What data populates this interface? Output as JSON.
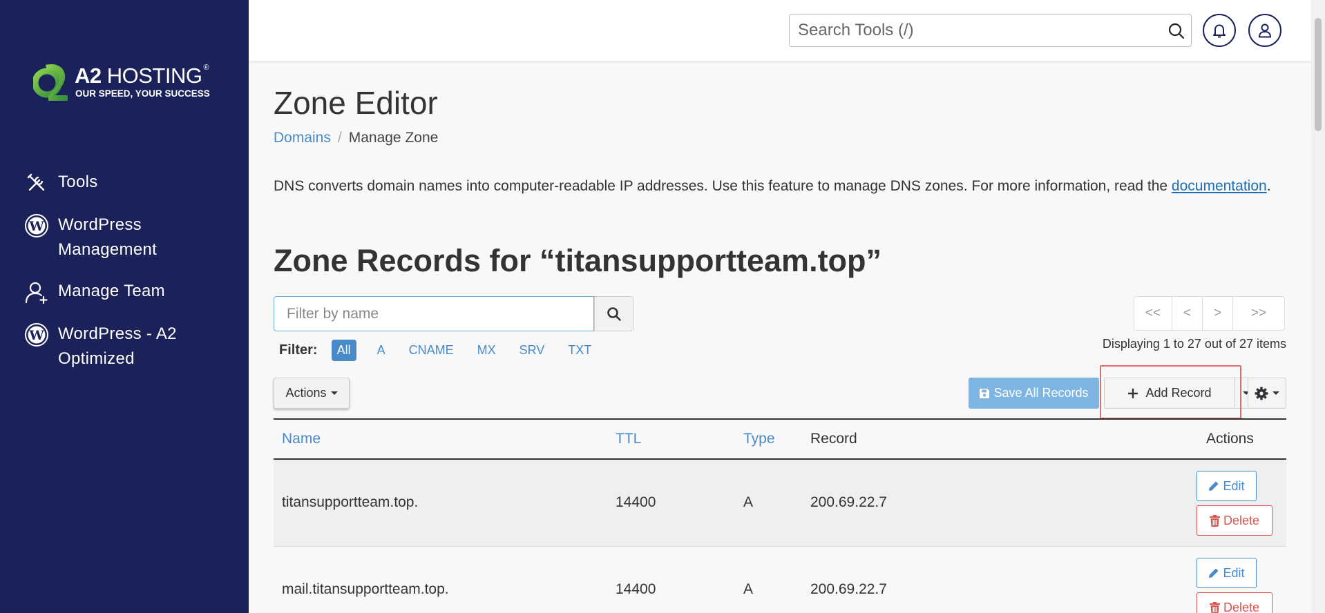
{
  "sidebar": {
    "logo_word_bold": "A2",
    "logo_word": "HOSTING",
    "logo_reg": "®",
    "logo_tagline": "OUR SPEED, YOUR SUCCESS",
    "items": [
      {
        "label": "Tools",
        "icon": "tools-icon"
      },
      {
        "label": "WordPress Management",
        "icon": "wordpress-icon"
      },
      {
        "label": "Manage Team",
        "icon": "user-plus-icon"
      },
      {
        "label": "WordPress - A2 Optimized",
        "icon": "wordpress-icon"
      }
    ]
  },
  "topbar": {
    "search_placeholder": "Search Tools (/)"
  },
  "page": {
    "title": "Zone Editor",
    "breadcrumb": {
      "link": "Domains",
      "separator": "/",
      "current": "Manage Zone"
    },
    "description_text": "DNS converts domain names into computer-readable IP addresses. Use this feature to manage DNS zones. For more information, read the",
    "description_link": "documentation",
    "description_end": ".",
    "zone_title": "Zone Records for “titansupportteam.top”"
  },
  "filter": {
    "placeholder": "Filter by name",
    "label": "Filter:",
    "chips": [
      "All",
      "A",
      "CNAME",
      "MX",
      "SRV",
      "TXT"
    ],
    "active": "All"
  },
  "pager": {
    "first": "<<",
    "prev": "<",
    "next": ">",
    "last": ">>",
    "displaying": "Displaying 1 to 27 out of 27 items"
  },
  "toolbar": {
    "actions_label": "Actions",
    "save_label": "Save All Records",
    "add_label": "Add Record"
  },
  "table": {
    "headers": {
      "name": "Name",
      "ttl": "TTL",
      "type": "Type",
      "record": "Record",
      "actions": "Actions"
    },
    "rows": [
      {
        "name": "titansupportteam.top.",
        "ttl": "14400",
        "type": "A",
        "record": "200.69.22.7"
      },
      {
        "name": "mail.titansupportteam.top.",
        "ttl": "14400",
        "type": "A",
        "record": "200.69.22.7"
      }
    ],
    "edit_label": "Edit",
    "delete_label": "Delete"
  },
  "colors": {
    "sidebar_bg": "#1b2259",
    "link": "#4a8ac9",
    "danger": "#d9534f",
    "highlight": "#e26b6b",
    "logo_green": "#6fbf3f"
  }
}
